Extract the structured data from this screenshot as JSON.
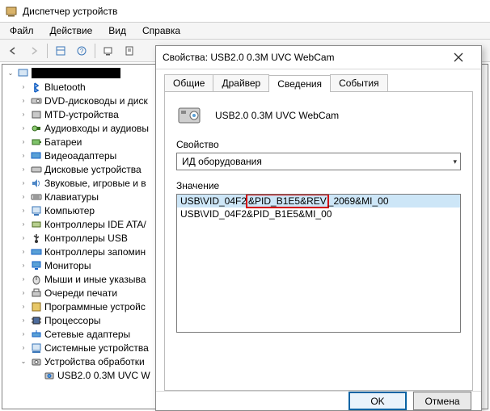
{
  "main": {
    "title": "Диспетчер устройств",
    "menu": {
      "file": "Файл",
      "action": "Действие",
      "view": "Вид",
      "help": "Справка"
    },
    "tree": {
      "root": "",
      "items": [
        {
          "icon": "bluetooth",
          "label": "Bluetooth"
        },
        {
          "icon": "disc",
          "label": "DVD-дисководы и диск"
        },
        {
          "icon": "mtd",
          "label": "MTD-устройства"
        },
        {
          "icon": "audio",
          "label": "Аудиовходы и аудиовы"
        },
        {
          "icon": "battery",
          "label": "Батареи"
        },
        {
          "icon": "video",
          "label": "Видеоадаптеры"
        },
        {
          "icon": "diskdrv",
          "label": "Дисковые устройства"
        },
        {
          "icon": "sound",
          "label": "Звуковые, игровые и в"
        },
        {
          "icon": "keyboard",
          "label": "Клавиатуры"
        },
        {
          "icon": "computer",
          "label": "Компьютер"
        },
        {
          "icon": "ide",
          "label": "Контроллеры IDE ATA/"
        },
        {
          "icon": "usb",
          "label": "Контроллеры USB"
        },
        {
          "icon": "storage",
          "label": "Контроллеры запомин"
        },
        {
          "icon": "monitor",
          "label": "Мониторы"
        },
        {
          "icon": "mouse",
          "label": "Мыши и иные указыва"
        },
        {
          "icon": "printq",
          "label": "Очереди печати"
        },
        {
          "icon": "software",
          "label": "Программные устройс"
        },
        {
          "icon": "cpu",
          "label": "Процессоры"
        },
        {
          "icon": "net",
          "label": "Сетевые адаптеры"
        },
        {
          "icon": "system",
          "label": "Системные устройства"
        },
        {
          "icon": "imaging",
          "label": "Устройства обработки",
          "expanded": true,
          "children": [
            {
              "icon": "webcam",
              "label": "USB2.0 0.3M UVC W"
            }
          ]
        }
      ]
    }
  },
  "dialog": {
    "title": "Свойства: USB2.0 0.3M UVC WebCam",
    "tabs": {
      "general": "Общие",
      "driver": "Драйвер",
      "details": "Сведения",
      "events": "События"
    },
    "device_name": "USB2.0 0.3M UVC WebCam",
    "property_label": "Свойство",
    "property_value": "ИД оборудования",
    "value_label": "Значение",
    "values": {
      "row0_pre": "USB\\VID_04F2",
      "row0_red": "&PID_B1E5&REV",
      "row0_post": "_2069&MI_00",
      "row1": "USB\\VID_04F2&PID_B1E5&MI_00"
    },
    "ok": "OK",
    "cancel": "Отмена"
  }
}
